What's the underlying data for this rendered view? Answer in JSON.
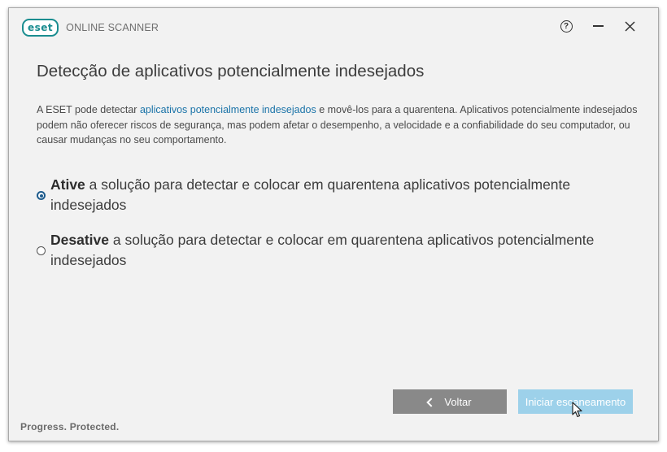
{
  "app": {
    "logo_text": "eset",
    "product_name": "ONLINE SCANNER"
  },
  "window_controls": {
    "help_label": "?",
    "close_label": "✕"
  },
  "page": {
    "title": "Detecção de aplicativos potencialmente indesejados",
    "description_before_link": "A ESET pode detectar ",
    "description_link": "aplicativos potencialmente indesejados",
    "description_after_link": " e movê-los para a quarentena. Aplicativos potencialmente indesejados podem não oferecer riscos de segurança, mas podem afetar o desempenho, a velocidade e a confiabilidade do seu computador, ou causar mudanças no seu comportamento."
  },
  "options": [
    {
      "bold": "Ative",
      "rest": " a solução para detectar e colocar em quarentena aplicativos potencialmente indesejados",
      "selected": true
    },
    {
      "bold": "Desative",
      "rest": " a solução para detectar e colocar em quarentena aplicativos potencialmente indesejados",
      "selected": false
    }
  ],
  "buttons": {
    "back_label": "Voltar",
    "start_label": "Iniciar escaneamento"
  },
  "footer": {
    "tagline": "Progress. Protected."
  },
  "colors": {
    "brand": "#1a8d90",
    "link": "#1a73a8",
    "radio_selected": "#1e5c8d",
    "back_button": "#898989",
    "start_button": "#9dd1ea"
  }
}
